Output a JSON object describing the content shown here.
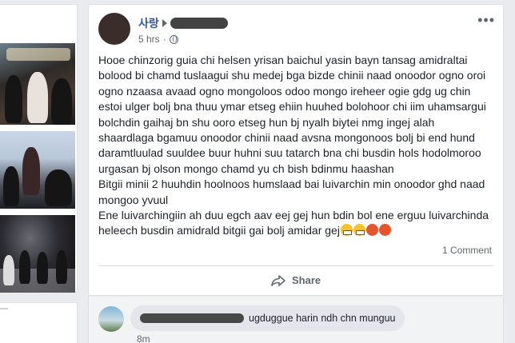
{
  "post": {
    "author": "사랑",
    "time": "5 hrs",
    "more": "•••",
    "lines": [
      "Hooe chinzorig guia chi helsen yrisan baichul yasin bayn tansag amidraltai",
      "bolood bi chamd tuslaagui shu medej bga bizde chinii naad onoodor ogno oroi",
      "ogno nzaasa avaad ogno mongoloos odoo mongo ireheer ogie gdg ug chin",
      "estoi ulger bolj bna thuu ymar etseg ehiin huuhed bolohoor chi iim uhamsargui",
      "bolchdin gaihaj bn shu ooro etseg hun bj nyalh biytei nmg ingej alah",
      "shaardlaga bgamuu onoodor chinii naad avsna mongonoos bolj bi end hund",
      "daramtluulad suuldee buur huhni suu tatarch bna chi busdin hols hodolmoroo",
      "urgasan bj olson mongo chamd yu ch bish bdinmu haashan",
      "Bitgii minii 2 huuhdin hoolnoos humslaad bai luivarchin min onoodor ghd naad",
      "mongoo yvuul",
      "Ene luivarchingiin ah duu egch aav eej gej hun bdin bol ene erguu luivarchinda",
      "heleech busdin amidrald bitgii gai bolj amidar gej"
    ],
    "comment_count": "1 Comment",
    "share_label": "Share"
  },
  "comment": {
    "text": "ugduggue harin ndh chn munguu",
    "time": "8m"
  },
  "icons": {
    "audience": "globe-icon",
    "share": "share-arrow-icon",
    "more": "more-options-icon"
  },
  "colors": {
    "link": "#365899",
    "text": "#1d2129",
    "meta": "#616770",
    "background": "#e9ebee"
  }
}
